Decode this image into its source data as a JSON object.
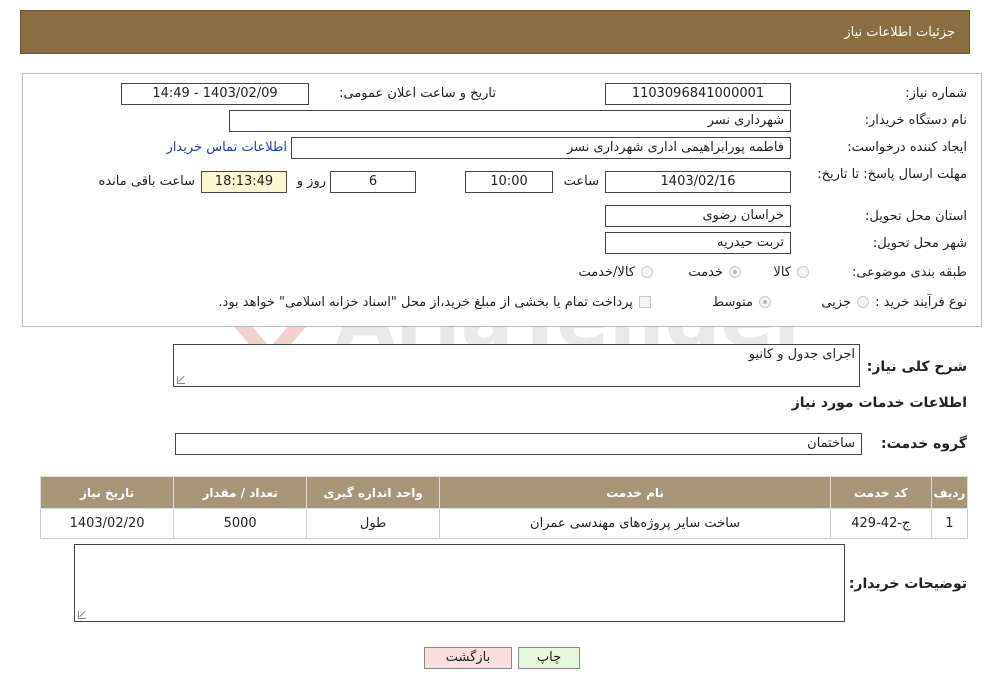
{
  "header": {
    "title": "جزئیات اطلاعات نیاز"
  },
  "form": {
    "need_number": {
      "label": "شماره نیاز:",
      "value": "1103096841000001"
    },
    "announce_datetime": {
      "label": "تاریخ و ساعت اعلان عمومی:",
      "value": "1403/02/09 - 14:49"
    },
    "buyer_org": {
      "label": "نام دستگاه خریدار:",
      "value": "شهرداری نسر"
    },
    "requester": {
      "label": "ایجاد کننده درخواست:",
      "value": "فاطمه پورابراهیمی اداری شهرداری نسر",
      "contact_link": "اطلاعات تماس خریدار"
    },
    "deadline": {
      "label": "مهلت ارسال پاسخ: تا تاریخ:",
      "date": "1403/02/16",
      "time_label": "ساعت",
      "time": "10:00",
      "days": "6",
      "days_label": "روز و",
      "remaining": "18:13:49",
      "remaining_label": "ساعت باقی مانده"
    },
    "province": {
      "label": "استان محل تحویل:",
      "value": "خراسان رضوی"
    },
    "city": {
      "label": "شهر محل تحویل:",
      "value": "تربت حیدریه"
    },
    "category": {
      "label": "طبقه بندی موضوعی:",
      "options": [
        "کالا",
        "خدمت",
        "کالا/خدمت"
      ],
      "selected": "خدمت"
    },
    "purchase_type": {
      "label": "نوع فرآیند خرید :",
      "options": [
        "جزیی",
        "متوسط"
      ],
      "selected": "متوسط",
      "payment_note": "پرداخت تمام یا بخشی از مبلغ خرید،از محل \"اسناد خزانه اسلامی\" خواهد بود."
    }
  },
  "summary": {
    "label": "شرح کلی نیاز:",
    "value": "اجرای جدول و کانیو"
  },
  "services": {
    "title": "اطلاعات خدمات مورد نیاز",
    "group_label": "گروه خدمت:",
    "group_value": "ساختمان",
    "columns": [
      "ردیف",
      "کد خدمت",
      "نام خدمت",
      "واحد اندازه گیری",
      "تعداد / مقدار",
      "تاریخ نیاز"
    ],
    "rows": [
      [
        "1",
        "ج-42-429",
        "ساخت سایر پروژه‌های مهندسی عمران",
        "طول",
        "5000",
        "1403/02/20"
      ]
    ]
  },
  "buyer_notes": {
    "label": "توضیحات خریدار:",
    "value": ""
  },
  "buttons": {
    "print": "چاپ",
    "back": "بازگشت"
  },
  "watermark": {
    "text": "AriaTender.neT"
  },
  "colors": {
    "header_bg": "#8b6d42",
    "table_header_bg": "#a89578",
    "back_button_bg": "#fbdede",
    "print_button_bg": "#e6f7dc"
  }
}
